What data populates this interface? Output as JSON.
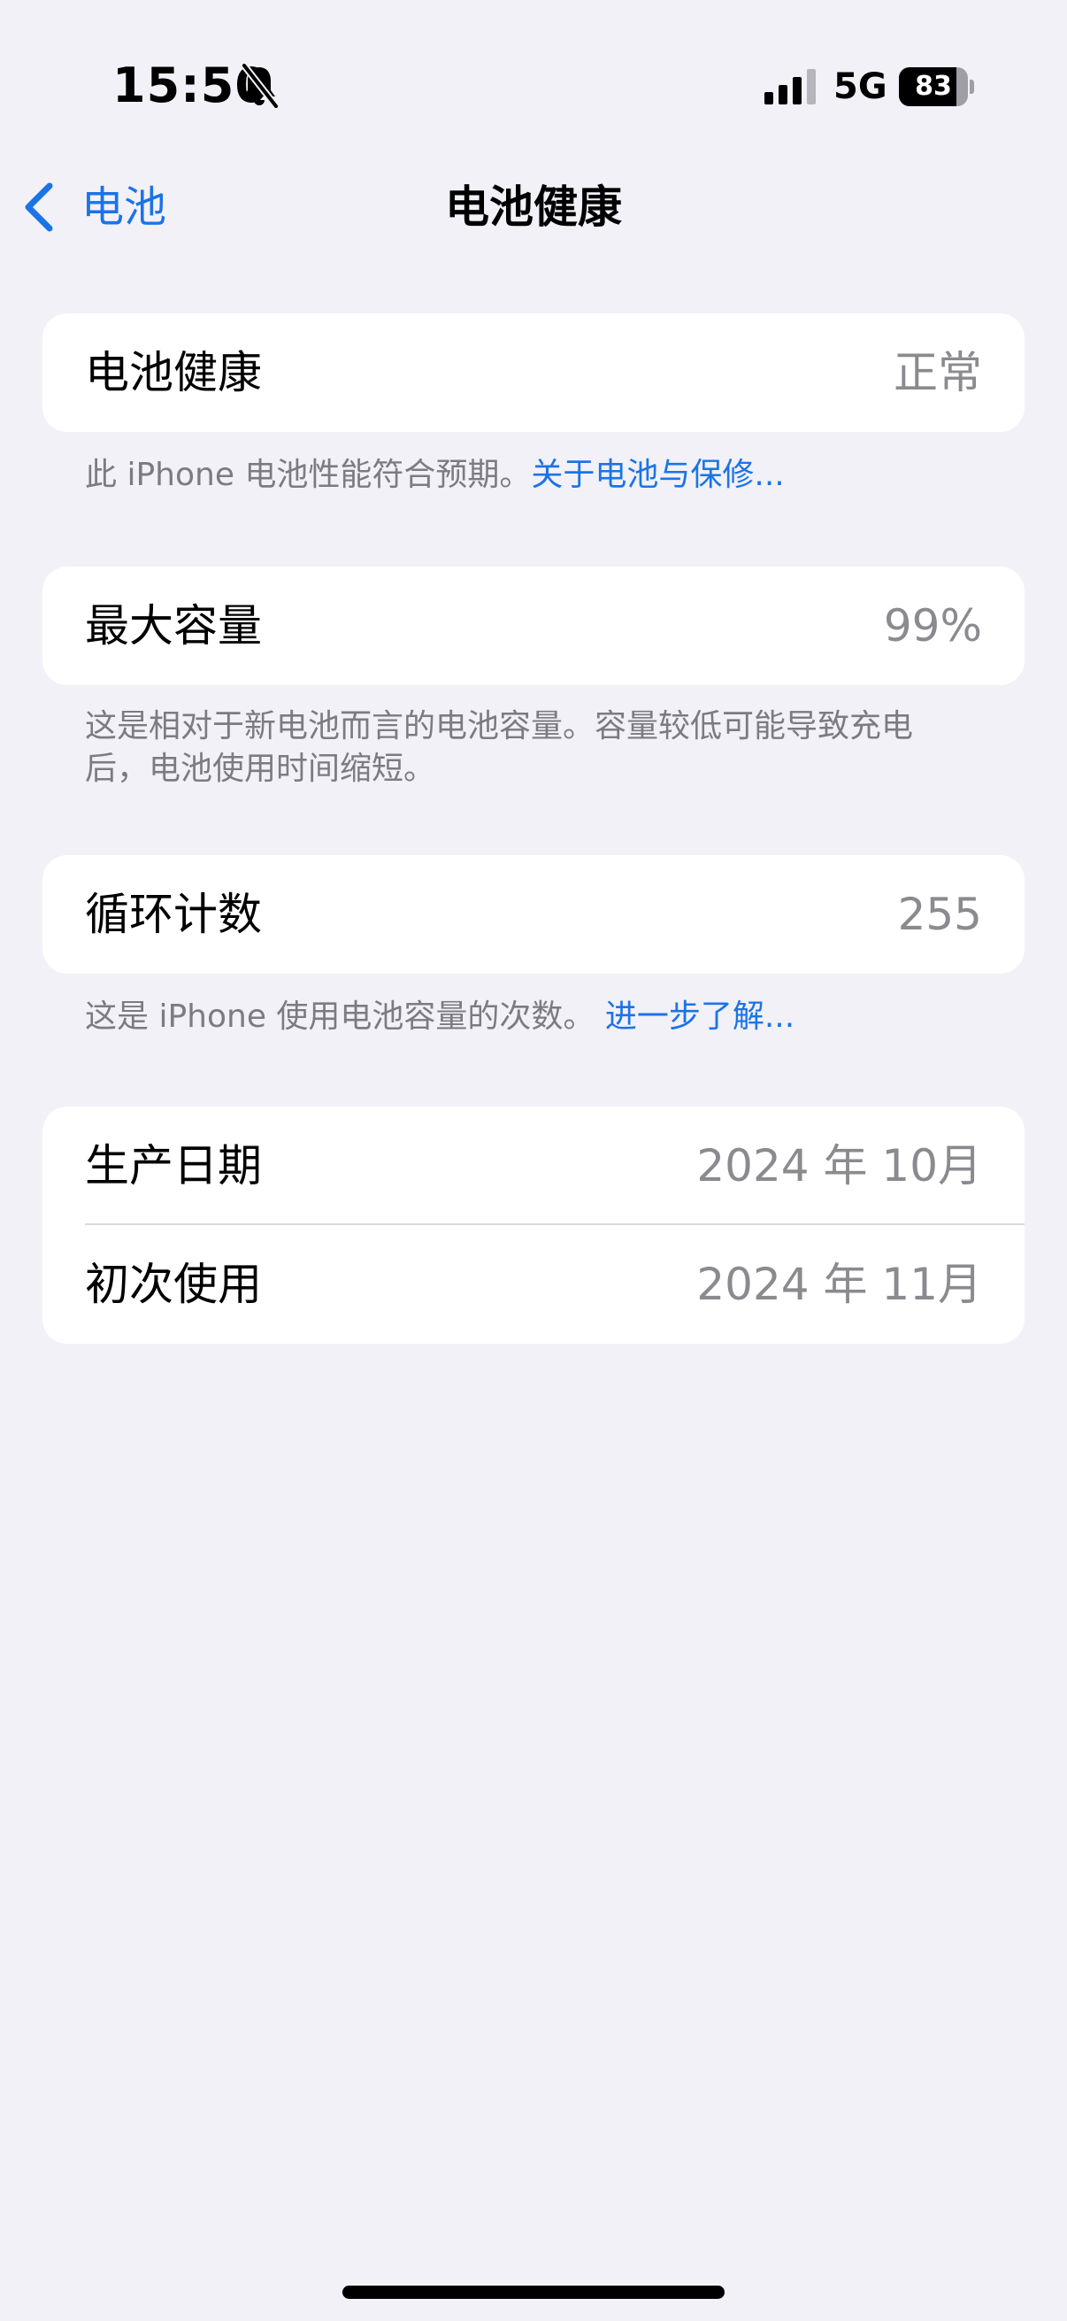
{
  "status_bar": {
    "time": "15:50",
    "network": "5G",
    "battery_level": "83",
    "battery_fraction": 0.83,
    "icons": [
      "bell-slash-icon",
      "cellular-signal-icon",
      "battery-icon"
    ]
  },
  "nav": {
    "back_label": "电池",
    "title": "电池健康",
    "back_icon": "chevron-left-icon"
  },
  "colors": {
    "accent": "#1b74e6",
    "background": "#f2f1f7",
    "secondary_text": "#8a8a8f"
  },
  "sections": {
    "health": {
      "label": "电池健康",
      "value": "正常",
      "footnote": "此 iPhone 电池性能符合预期。",
      "footnote_link": "关于电池与保修..."
    },
    "capacity": {
      "label": "最大容量",
      "value": "99%",
      "footnote": "这是相对于新电池而言的电池容量。容量较低可能导致充电后，电池使用时间缩短。"
    },
    "cycles": {
      "label": "循环计数",
      "value": "255",
      "footnote": "这是 iPhone 使用电池容量的次数。 ",
      "footnote_link": "进一步了解..."
    },
    "dates": {
      "manufacture_label": "生产日期",
      "manufacture_value": "2024 年 10月",
      "first_use_label": "初次使用",
      "first_use_value": "2024 年 11月"
    }
  }
}
